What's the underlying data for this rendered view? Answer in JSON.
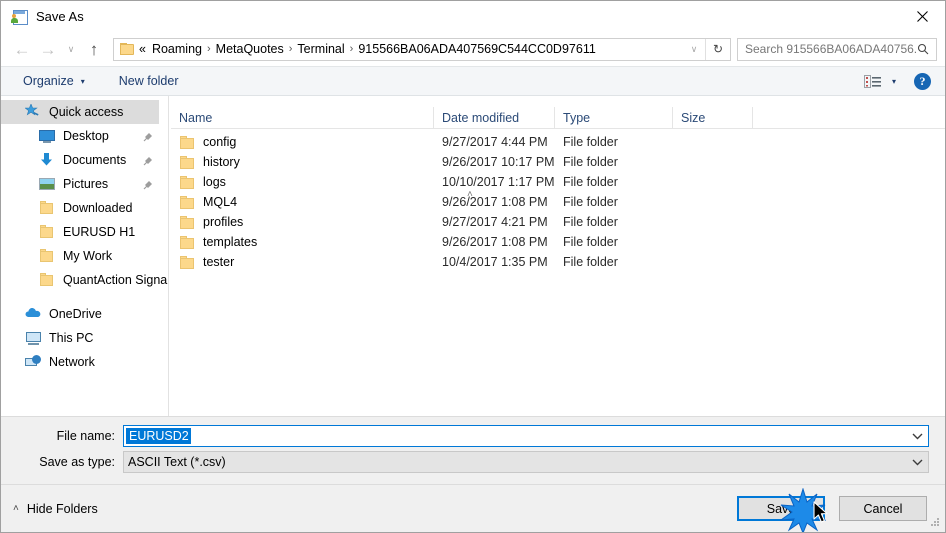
{
  "window": {
    "title": "Save As",
    "icon": "save-as-icon",
    "close_label": "✕"
  },
  "nav": {
    "back": "←",
    "forward": "→",
    "recent": "∨",
    "up": "↑",
    "breadcrumb_prefix": "«",
    "breadcrumb": [
      "Roaming",
      "MetaQuotes",
      "Terminal",
      "915566BA06ADA407569C544CC0D97611"
    ],
    "breadcrumb_separator": "›",
    "dropdown": "∨",
    "refresh": "↻"
  },
  "search": {
    "placeholder": "Search 915566BA06ADA40756...",
    "icon": "search-icon"
  },
  "toolbar": {
    "organize_label": "Organize",
    "organize_caret": "▾",
    "new_folder_label": "New folder",
    "view_caret": "▾",
    "help_label": "?"
  },
  "sidebar": {
    "quick_access": {
      "label": "Quick access",
      "icon": "star-pin-icon",
      "selected": true
    },
    "pinned": [
      {
        "label": "Desktop",
        "icon": "monitor-icon",
        "pinned": true
      },
      {
        "label": "Documents",
        "icon": "documents-arrow-icon",
        "pinned": true
      },
      {
        "label": "Pictures",
        "icon": "picture-icon",
        "pinned": true
      },
      {
        "label": "Downloaded",
        "icon": "folder-icon",
        "pinned": false
      },
      {
        "label": "EURUSD H1",
        "icon": "folder-icon",
        "pinned": false
      },
      {
        "label": "My Work",
        "icon": "folder-icon",
        "pinned": false
      },
      {
        "label": "QuantAction Signal",
        "icon": "folder-icon",
        "pinned": false
      }
    ],
    "roots": [
      {
        "label": "OneDrive",
        "icon": "cloud-icon"
      },
      {
        "label": "This PC",
        "icon": "computer-icon"
      },
      {
        "label": "Network",
        "icon": "network-icon"
      }
    ]
  },
  "filelist": {
    "sort_caret": "˄",
    "columns": [
      "Name",
      "Date modified",
      "Type",
      "Size"
    ],
    "rows": [
      {
        "name": "config",
        "date": "9/27/2017 4:44 PM",
        "type": "File folder",
        "size": ""
      },
      {
        "name": "history",
        "date": "9/26/2017 10:17 PM",
        "type": "File folder",
        "size": ""
      },
      {
        "name": "logs",
        "date": "10/10/2017 1:17 PM",
        "type": "File folder",
        "size": ""
      },
      {
        "name": "MQL4",
        "date": "9/26/2017 1:08 PM",
        "type": "File folder",
        "size": ""
      },
      {
        "name": "profiles",
        "date": "9/27/2017 4:21 PM",
        "type": "File folder",
        "size": ""
      },
      {
        "name": "templates",
        "date": "9/26/2017 1:08 PM",
        "type": "File folder",
        "size": ""
      },
      {
        "name": "tester",
        "date": "10/4/2017 1:35 PM",
        "type": "File folder",
        "size": ""
      }
    ]
  },
  "form": {
    "filename_label": "File name:",
    "filename_value": "EURUSD2",
    "filetype_label": "Save as type:",
    "filetype_value": "ASCII Text (*.csv)",
    "dropdown_glyph": "⌄"
  },
  "footer": {
    "hide_folders_label": "Hide Folders",
    "hide_folders_caret": "˄",
    "save_label": "Save",
    "cancel_label": "Cancel"
  },
  "colors": {
    "accent": "#0078d7",
    "folder": "#fcd88b",
    "header_text": "#2b4a77",
    "toolbar_bg": "#f4f6f8",
    "form_bg": "#f0f0f0",
    "selection": "#dcdcdc"
  }
}
